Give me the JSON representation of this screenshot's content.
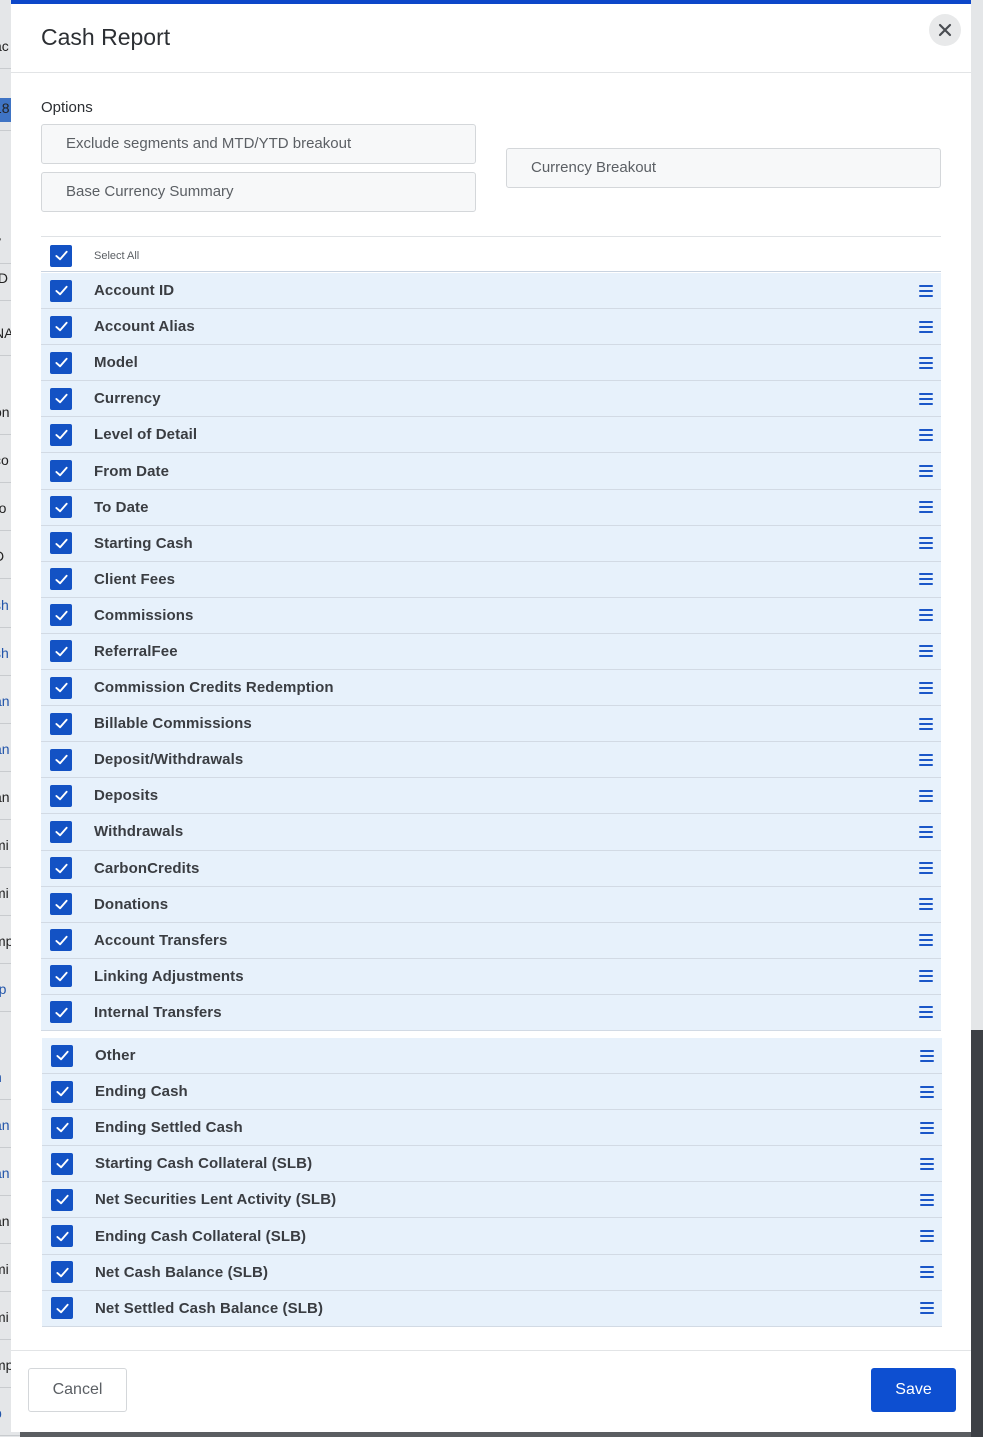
{
  "backdrop": {
    "fragments": [
      "ac",
      "18",
      "y",
      "ID",
      "NA",
      "on",
      "co",
      "ro",
      "D",
      "sh",
      "sh",
      "an",
      "an",
      "an",
      "mi",
      "mi",
      "mp",
      "rp",
      "h",
      "an",
      "an",
      "an",
      "mi",
      "mi",
      "mp",
      "p"
    ]
  },
  "modal": {
    "title": "Cash Report",
    "close_icon": "close-icon"
  },
  "options": {
    "label": "Options",
    "exclude_segments": "Exclude segments and MTD/YTD breakout",
    "base_currency_summary": "Base Currency Summary",
    "currency_breakout": "Currency Breakout"
  },
  "select_all": {
    "label": "Select All",
    "checked": true
  },
  "columns_group1": [
    "Account ID",
    "Account Alias",
    "Model",
    "Currency",
    "Level of Detail",
    "From Date",
    "To Date",
    "Starting Cash",
    "Client Fees",
    "Commissions",
    "ReferralFee",
    "Commission Credits Redemption",
    "Billable Commissions",
    "Deposit/Withdrawals",
    "Deposits",
    "Withdrawals",
    "CarbonCredits",
    "Donations",
    "Account Transfers",
    "Linking Adjustments",
    "Internal Transfers"
  ],
  "columns_group2": [
    "Other",
    "Ending Cash",
    "Ending Settled Cash",
    "Starting Cash Collateral (SLB)",
    "Net Securities Lent Activity (SLB)",
    "Ending Cash Collateral (SLB)",
    "Net Cash Balance (SLB)",
    "Net Settled Cash Balance (SLB)"
  ],
  "icons": {
    "checkbox": "checkmark-icon",
    "drag": "drag-handle-icon"
  },
  "colors": {
    "primary": "#0d4fd1",
    "row_bg": "#e7f1fb",
    "checkbox": "#1352c4"
  },
  "footer": {
    "cancel_label": "Cancel",
    "save_label": "Save"
  }
}
